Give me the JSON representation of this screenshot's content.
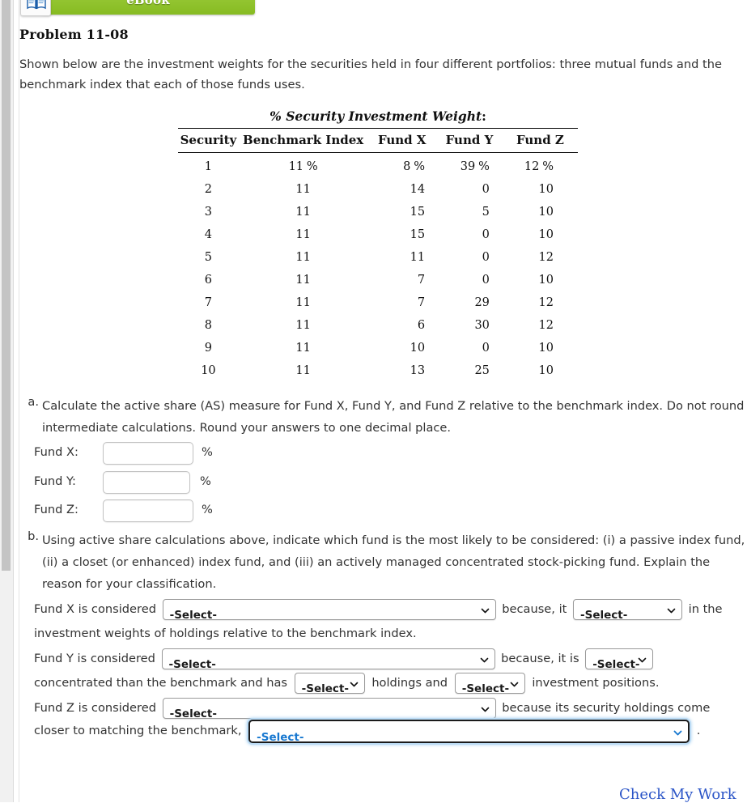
{
  "toolbar": {
    "ebook_label": "eBook",
    "ebook_icon": "open-book-icon",
    "green": "#8dc63f"
  },
  "problem": {
    "title": "Problem 11-08",
    "intro": "Shown below are the investment weights for the securities held in four different portfolios: three mutual funds and the benchmark index that each of those funds uses."
  },
  "table": {
    "caption_italic": "% Security Investment Weight",
    "caption_colon": ":",
    "columns": [
      "Security",
      "Benchmark Index",
      "Fund X",
      "Fund Y",
      "Fund Z"
    ],
    "rows": [
      {
        "security": "1",
        "benchmark": "11",
        "fund_x": "8",
        "fund_y": "39",
        "fund_z": "12",
        "pct": "%"
      },
      {
        "security": "2",
        "benchmark": "11",
        "fund_x": "14",
        "fund_y": "0",
        "fund_z": "10",
        "pct": ""
      },
      {
        "security": "3",
        "benchmark": "11",
        "fund_x": "15",
        "fund_y": "5",
        "fund_z": "10",
        "pct": ""
      },
      {
        "security": "4",
        "benchmark": "11",
        "fund_x": "15",
        "fund_y": "0",
        "fund_z": "10",
        "pct": ""
      },
      {
        "security": "5",
        "benchmark": "11",
        "fund_x": "11",
        "fund_y": "0",
        "fund_z": "12",
        "pct": ""
      },
      {
        "security": "6",
        "benchmark": "11",
        "fund_x": "7",
        "fund_y": "0",
        "fund_z": "10",
        "pct": ""
      },
      {
        "security": "7",
        "benchmark": "11",
        "fund_x": "7",
        "fund_y": "29",
        "fund_z": "12",
        "pct": ""
      },
      {
        "security": "8",
        "benchmark": "11",
        "fund_x": "6",
        "fund_y": "30",
        "fund_z": "12",
        "pct": ""
      },
      {
        "security": "9",
        "benchmark": "11",
        "fund_x": "10",
        "fund_y": "0",
        "fund_z": "10",
        "pct": ""
      },
      {
        "security": "10",
        "benchmark": "11",
        "fund_x": "13",
        "fund_y": "25",
        "fund_z": "10",
        "pct": ""
      }
    ]
  },
  "part_a": {
    "marker": "a.",
    "text": "Calculate the active share (AS) measure for Fund X, Fund Y, and Fund Z relative to the benchmark index. Do not round intermediate calculations. Round your answers to one decimal place.",
    "answers": [
      {
        "label": "Fund X:",
        "value": "",
        "unit": "%"
      },
      {
        "label": "Fund Y:",
        "value": "",
        "unit": "%"
      },
      {
        "label": "Fund Z:",
        "value": "",
        "unit": "%"
      }
    ]
  },
  "part_b": {
    "marker": "b.",
    "text": "Using active share calculations above, indicate which fund is the most likely to be considered: (i) a passive index fund, (ii) a closet (or enhanced) index fund, and (iii) an actively managed concentrated stock-picking fund. Explain the reason for your classification.",
    "select_placeholder": "-Select-",
    "fund_x_sentence": {
      "lead": "Fund X is considered",
      "mid": "because, it",
      "tail": "in the",
      "line2": "investment weights of holdings relative to the benchmark index."
    },
    "fund_y_sentence": {
      "lead": "Fund Y is considered",
      "mid": "because, it is",
      "line2_a": "concentrated than the benchmark and has",
      "line2_b": "holdings and",
      "line2_c": "investment positions."
    },
    "fund_z_sentence": {
      "lead": "Fund Z is considered",
      "mid": "because its security holdings come",
      "line2": "closer to matching the benchmark,",
      "period": "."
    }
  },
  "footer": {
    "check_my_work": "Check My Work",
    "link_color": "#2b55c7"
  }
}
